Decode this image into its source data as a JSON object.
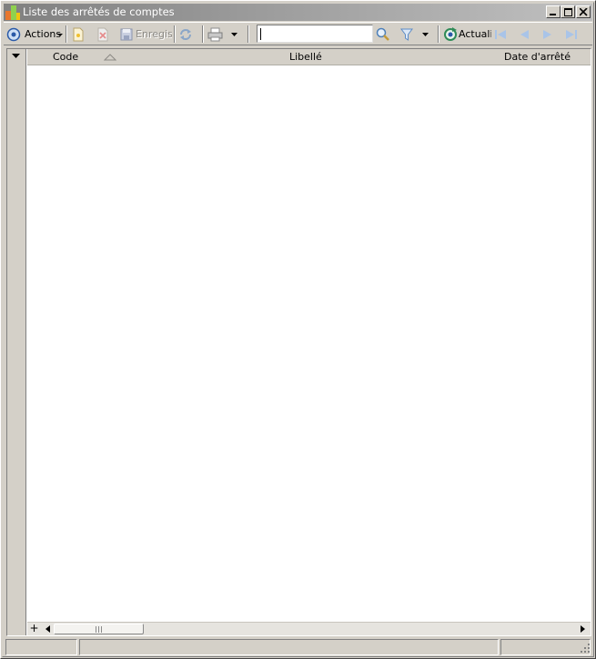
{
  "window": {
    "title": "Liste des arrêtés de comptes"
  },
  "toolbar": {
    "actions_label": "Actions",
    "save_label": "Enregist",
    "refresh_label": "Actualis",
    "search_value": "",
    "icons": {
      "actions": "actions-gear-icon",
      "new": "new-document-icon",
      "delete": "delete-icon",
      "save": "save-icon",
      "sync": "sync-icon",
      "print": "printer-icon",
      "print_dropdown": "chevron-down-icon",
      "search": "magnifier-icon",
      "filter": "funnel-icon",
      "filter_dropdown": "chevron-down-icon",
      "refresh": "refresh-icon",
      "first": "first-record-icon",
      "previous": "previous-record-icon",
      "next": "next-record-icon",
      "last": "last-record-icon"
    }
  },
  "grid": {
    "columns": [
      {
        "label": "Code",
        "sorted": "ascending"
      },
      {
        "label": "Libellé"
      },
      {
        "label": "Date d'arrêté"
      }
    ],
    "rows": []
  },
  "statusbar": {
    "panes": [
      "",
      "",
      ""
    ]
  },
  "colors": {
    "window_bg": "#d4d0c8",
    "title_gradient_start": "#808080",
    "title_gradient_end": "#c0c0c0",
    "nav_arrow_disabled": "#a9c4e8"
  }
}
